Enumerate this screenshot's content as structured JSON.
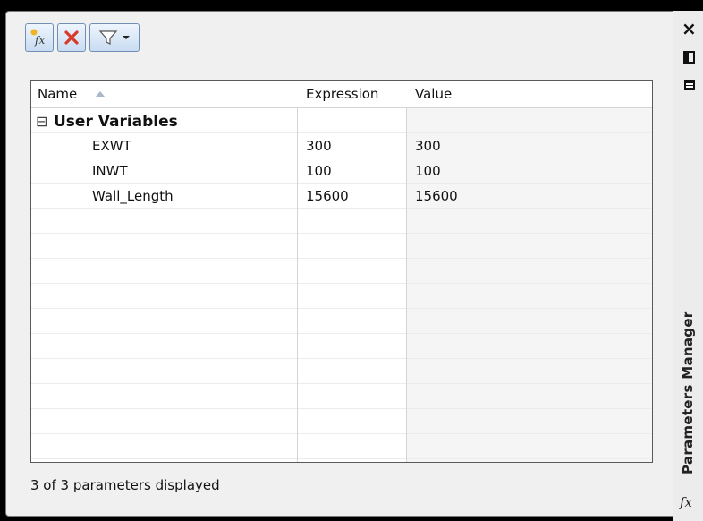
{
  "toolbar": {
    "new_parameter_icon": "fx-new-icon",
    "delete_icon": "delete-x-icon",
    "filter_icon": "filter-funnel-icon"
  },
  "grid": {
    "columns": [
      "Name",
      "Expression",
      "Value"
    ],
    "sort_indicator": "ascending",
    "group_label": "User Variables",
    "group_toggle": "⊟",
    "rows": [
      {
        "name": "EXWT",
        "expression": "300",
        "value": "300"
      },
      {
        "name": "INWT",
        "expression": "100",
        "value": "100"
      },
      {
        "name": "Wall_Length",
        "expression": "15600",
        "value": "15600"
      }
    ]
  },
  "status": "3 of 3 parameters displayed",
  "side": {
    "title": "Parameters Manager",
    "close": "×",
    "fx": "fx"
  },
  "colors": {
    "background": "#000000",
    "panel": "#f0f0f0",
    "grid": "#ffffff",
    "delete_red": "#d83a2a"
  }
}
